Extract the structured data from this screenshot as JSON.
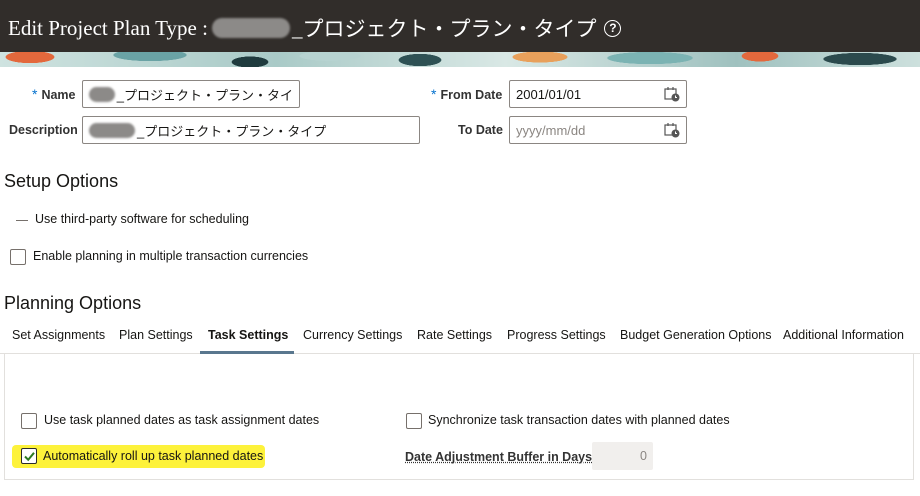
{
  "header": {
    "title_prefix": "Edit Project Plan Type :",
    "title_suffix": "_プロジェクト・プラン・タイプ",
    "help_symbol": "?"
  },
  "form": {
    "name_label": "Name",
    "name_value": "_プロジェクト・プラン・タイ",
    "description_label": "Description",
    "description_value": "_プロジェクト・プラン・タイプ",
    "from_date_label": "From Date",
    "from_date_value": "2001/01/01",
    "to_date_label": "To Date",
    "to_date_placeholder": "yyyy/mm/dd",
    "required_marker": "*"
  },
  "setup_options": {
    "title": "Setup Options",
    "third_party_label": "Use third-party software for scheduling",
    "multi_currency_label": "Enable planning in multiple transaction currencies"
  },
  "planning_options": {
    "title": "Planning Options",
    "tabs": [
      {
        "label": "Set Assignments"
      },
      {
        "label": "Plan Settings"
      },
      {
        "label": "Task Settings"
      },
      {
        "label": "Currency Settings"
      },
      {
        "label": "Rate Settings"
      },
      {
        "label": "Progress Settings"
      },
      {
        "label": "Budget Generation Options"
      },
      {
        "label": "Additional Information"
      }
    ],
    "active_tab": "Task Settings"
  },
  "task_settings": {
    "use_task_dates_label": "Use task planned dates as task assignment dates",
    "use_task_dates_checked": false,
    "sync_dates_label": "Synchronize task transaction dates with planned dates",
    "sync_dates_checked": false,
    "rollup_label": "Automatically roll up task planned dates",
    "rollup_checked": true,
    "buffer_label": "Date Adjustment Buffer in Days",
    "buffer_value": "0"
  },
  "colors": {
    "header_bg": "#312d2a",
    "highlight": "#fdf23b",
    "active_tab_underline": "#59778e",
    "required": "#0572ce"
  }
}
